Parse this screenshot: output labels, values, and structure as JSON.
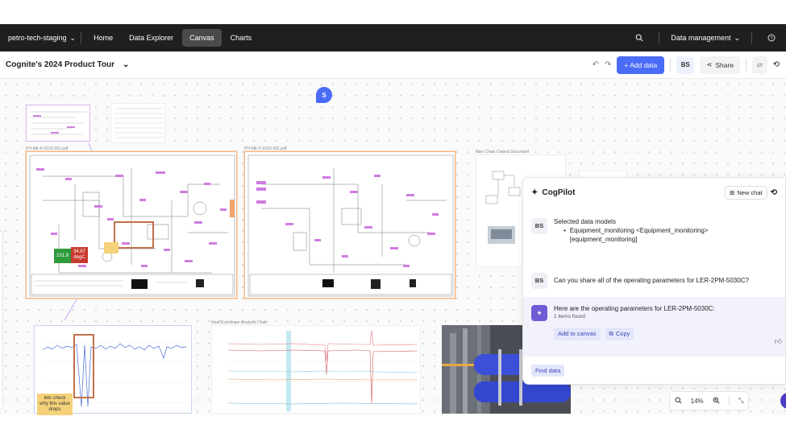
{
  "topnav": {
    "project": "petro-tech-staging",
    "items": [
      "Home",
      "Data Explorer",
      "Canvas",
      "Charts"
    ],
    "active_item": "Canvas",
    "data_management": "Data management"
  },
  "toolbar": {
    "title": "Cognite's 2024 Product Tour",
    "add_data": "+ Add data",
    "user_initials": "BS",
    "share": "Share"
  },
  "canvas": {
    "presence_initial": "S",
    "doc1_label": "PH-ME-P-0102-001.pdf",
    "doc2_label": "PH-ME-P-0102-001.pdf",
    "doc3_label": "New Chain Central Document",
    "chart1_label": "Heat Exchanger Analysis Chart",
    "gauge_green": "101.9",
    "gauge_red_value": "34.67",
    "gauge_red_unit": "degC",
    "sticky_note": "lets check why this value drops"
  },
  "copilot": {
    "title": "CogPilot",
    "new_chat": "New chat",
    "user_initials": "BS",
    "msg1_title": "Selected data models",
    "msg1_bullet": "Equipment_monitoring <Equipment_monitoring> [equipment_monitoring]",
    "msg2": "Can you share all of the operating parameters for LER-2PM-5030C?",
    "bot_msg": "Here are the operating parameters for LER-2PM-5030C:",
    "bot_sub": "1 items found",
    "add_to_canvas": "Add to canvas",
    "copy": "Copy",
    "find_data": "Find data"
  },
  "zoom": {
    "level": "14%"
  },
  "colors": {
    "accent": "#4a6cf7",
    "nav_bg": "#1f1f1f",
    "tag": "#cf7de0",
    "selection": "#f2b98a"
  }
}
